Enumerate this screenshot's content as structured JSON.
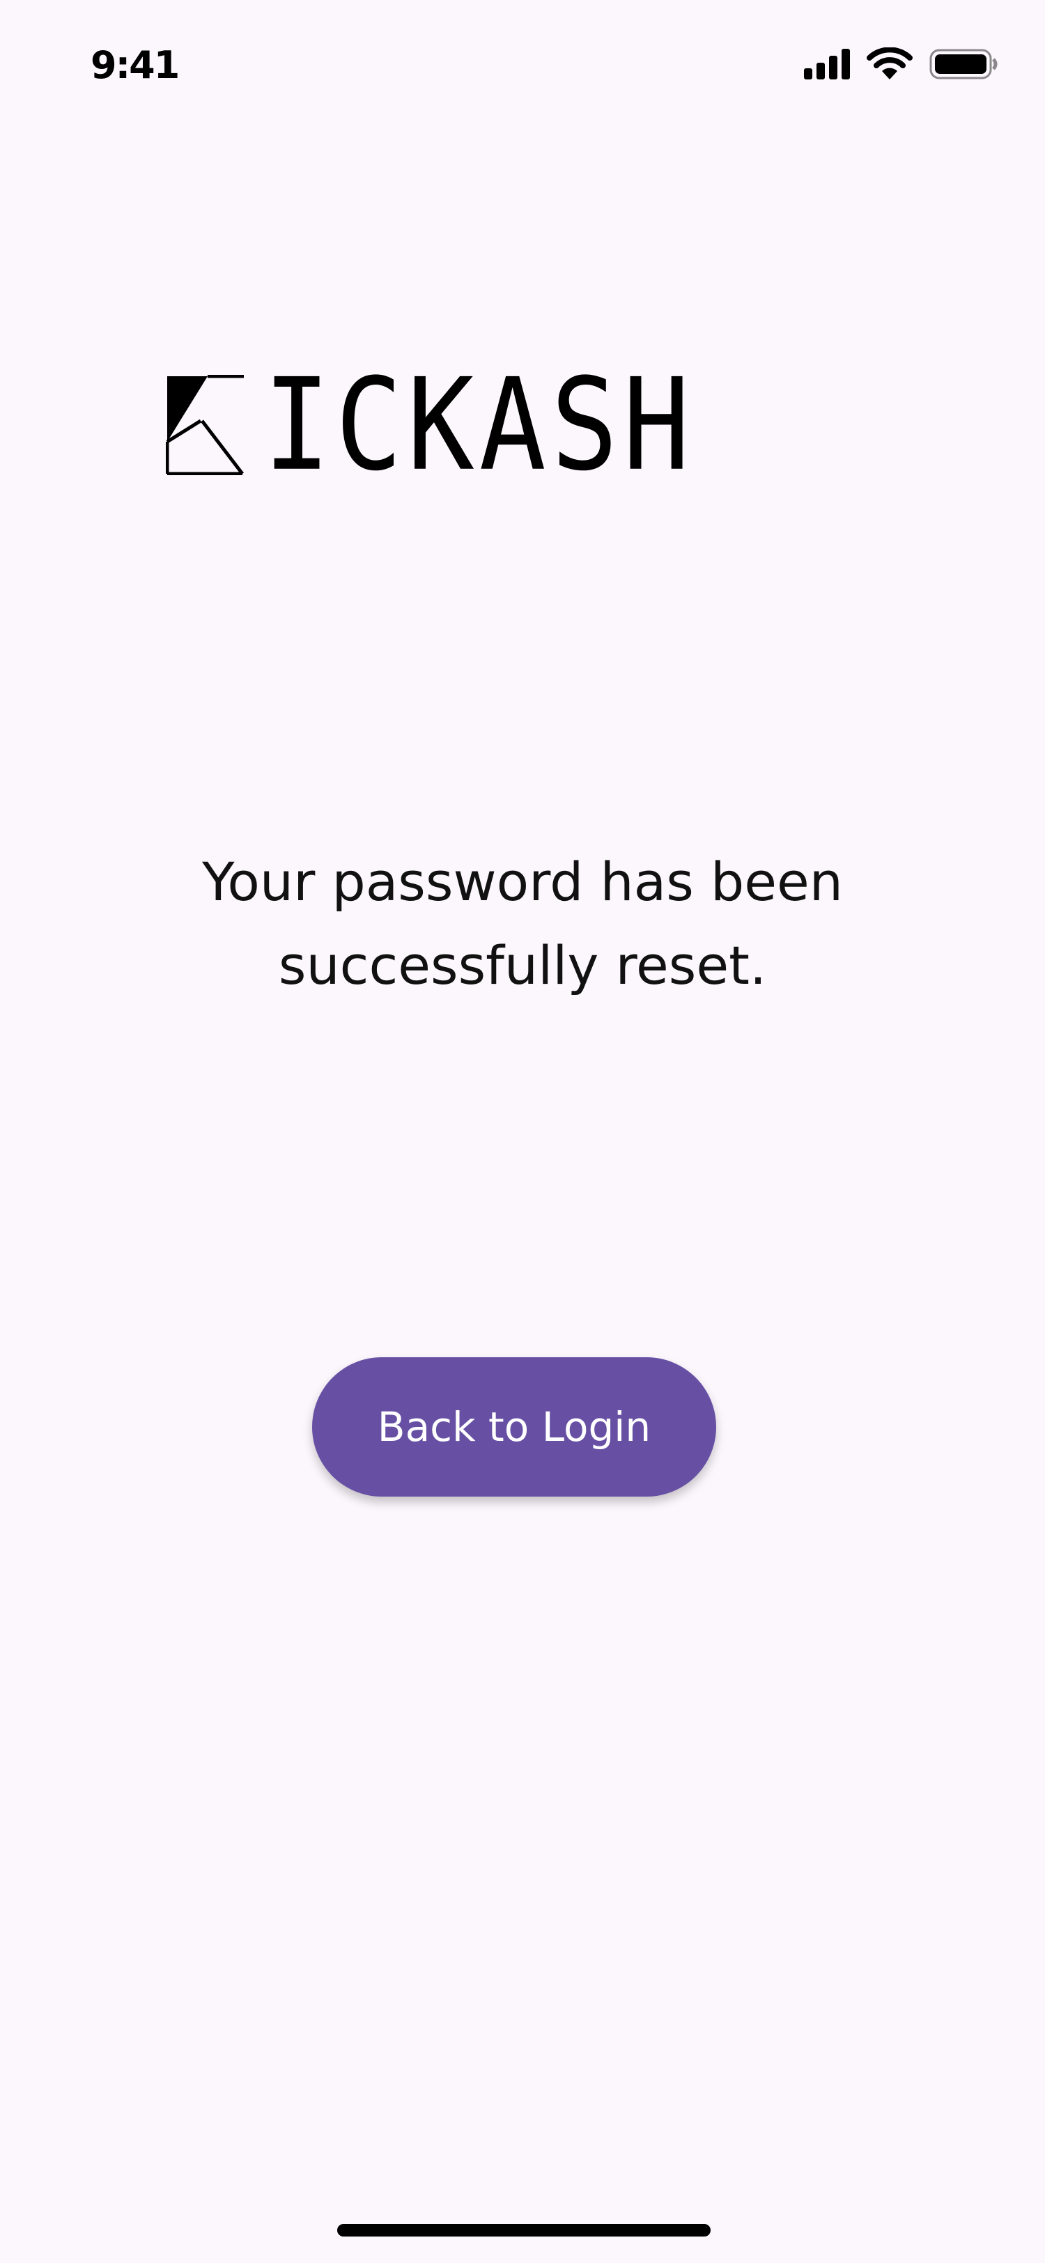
{
  "status_bar": {
    "time": "9:41",
    "icons": [
      "cellular-signal-icon",
      "wifi-icon",
      "battery-icon"
    ]
  },
  "logo": {
    "text": "ICKASH",
    "full_name": "KICKASH"
  },
  "message": {
    "line1": "Your password has been",
    "line2": "successfully reset."
  },
  "button": {
    "label": "Back to Login"
  },
  "colors": {
    "background": "#FCF7FD",
    "primary": "#6750A4",
    "text": "#111111",
    "button_text": "#FFFFFF"
  }
}
